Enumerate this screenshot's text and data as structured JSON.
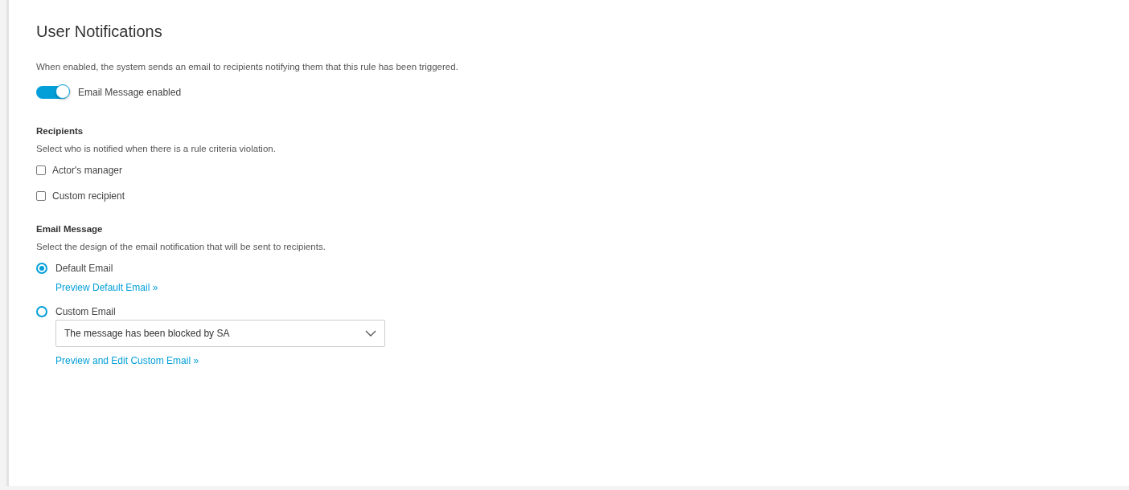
{
  "title": "User Notifications",
  "description": "When enabled, the system sends an email to recipients notifying them that this rule has been triggered.",
  "toggle": {
    "label": "Email Message enabled",
    "on": true
  },
  "recipients": {
    "heading": "Recipients",
    "description": "Select who is notified when there is a rule criteria violation.",
    "options": [
      {
        "label": "Actor's manager",
        "checked": false
      },
      {
        "label": "Custom recipient",
        "checked": false
      }
    ]
  },
  "email_message": {
    "heading": "Email Message",
    "description": "Select the design of the email notification that will be sent to recipients.",
    "options": [
      {
        "label": "Default Email",
        "selected": true,
        "link": "Preview Default Email »"
      },
      {
        "label": "Custom Email",
        "selected": false,
        "dropdown": "The message has been blocked by SA",
        "link": "Preview and Edit Custom Email »"
      }
    ]
  }
}
